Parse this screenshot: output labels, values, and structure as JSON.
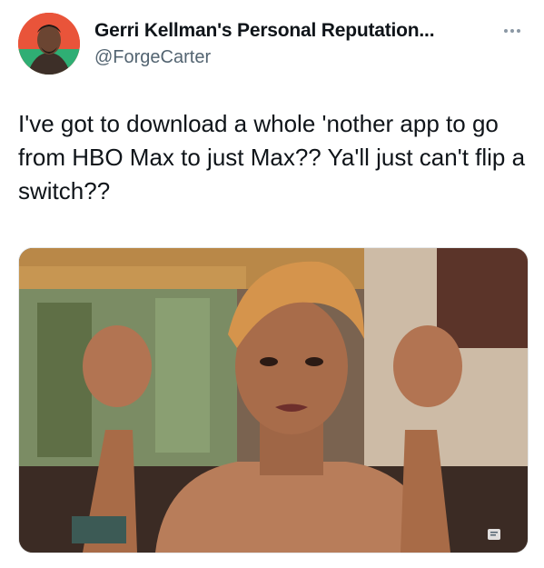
{
  "tweet": {
    "display_name": "Gerri Kellman's Personal Reputation...",
    "handle": "@ForgeCarter",
    "text": "I've got to download a whole 'nother app to go from HBO Max to just Max?? Ya'll just can't flip a switch??",
    "more_icon": "more-horizontal-icon",
    "media_description_icon": "gif-media-icon"
  },
  "colors": {
    "text": "#0f1419",
    "secondary": "#536471",
    "avatar_bg": "#f04a2e"
  }
}
